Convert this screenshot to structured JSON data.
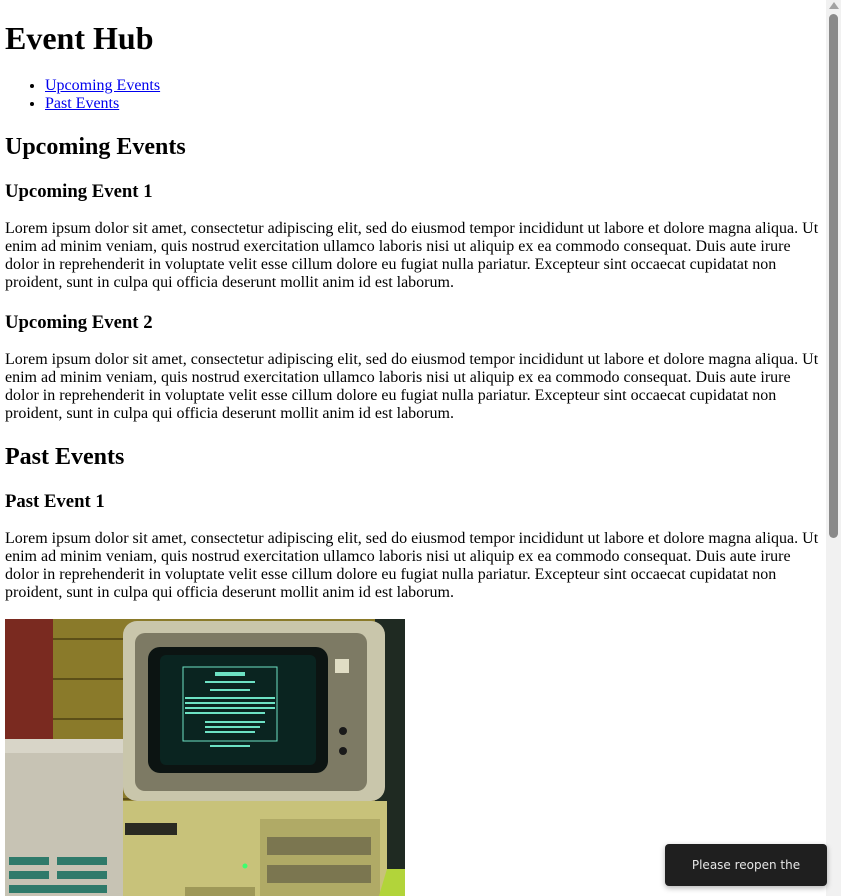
{
  "site": {
    "title": "Event Hub"
  },
  "nav": {
    "items": [
      {
        "label": "Upcoming Events"
      },
      {
        "label": "Past Events"
      }
    ]
  },
  "upcoming": {
    "heading": "Upcoming Events",
    "events": [
      {
        "title": "Upcoming Event 1",
        "description": "Lorem ipsum dolor sit amet, consectetur adipiscing elit, sed do eiusmod tempor incididunt ut labore et dolore magna aliqua. Ut enim ad minim veniam, quis nostrud exercitation ullamco laboris nisi ut aliquip ex ea commodo consequat. Duis aute irure dolor in reprehenderit in voluptate velit esse cillum dolore eu fugiat nulla pariatur. Excepteur sint occaecat cupidatat non proident, sunt in culpa qui officia deserunt mollit anim id est laborum."
      },
      {
        "title": "Upcoming Event 2",
        "description": "Lorem ipsum dolor sit amet, consectetur adipiscing elit, sed do eiusmod tempor incididunt ut labore et dolore magna aliqua. Ut enim ad minim veniam, quis nostrud exercitation ullamco laboris nisi ut aliquip ex ea commodo consequat. Duis aute irure dolor in reprehenderit in voluptate velit esse cillum dolore eu fugiat nulla pariatur. Excepteur sint occaecat cupidatat non proident, sunt in culpa qui officia deserunt mollit anim id est laborum."
      }
    ]
  },
  "past": {
    "heading": "Past Events",
    "events": [
      {
        "title": "Past Event 1",
        "description": "Lorem ipsum dolor sit amet, consectetur adipiscing elit, sed do eiusmod tempor incididunt ut labore et dolore magna aliqua. Ut enim ad minim veniam, quis nostrud exercitation ullamco laboris nisi ut aliquip ex ea commodo consequat. Duis aute irure dolor in reprehenderit in voluptate velit esse cillum dolore eu fugiat nulla pariatur. Excepteur sint occaecat cupidatat non proident, sunt in culpa qui officia deserunt mollit anim id est laborum."
      }
    ]
  },
  "toast": {
    "message": "Please reopen the preview."
  },
  "colors": {
    "link": "#0000EE",
    "toast_bg": "#1f1f1f",
    "scrollbar_thumb": "#8a8a8a"
  },
  "icons": {
    "scroll_up": "scroll-up-arrow-icon"
  }
}
